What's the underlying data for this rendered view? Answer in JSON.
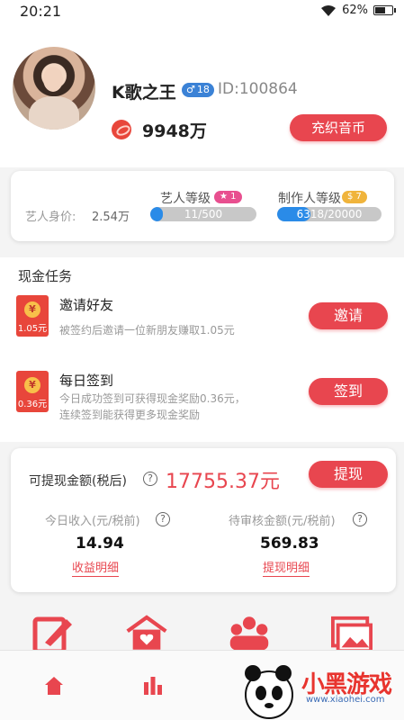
{
  "status_bar": {
    "time": "20:21",
    "battery": "62%",
    "battery_level": 0.62
  },
  "profile": {
    "nickname": "K歌之王",
    "gender_level": "18",
    "user_id": "ID:100864",
    "coins": "9948万",
    "recharge_label": "充织音币"
  },
  "value_card": {
    "worth_label": "艺人身价:",
    "worth_value": "2.54万",
    "artist": {
      "title": "艺人等级",
      "badge": "1",
      "progress_text": "11/500",
      "current": 11,
      "max": 500
    },
    "producer": {
      "title": "制作人等级",
      "badge": "7",
      "progress_text": "6318/20000",
      "current": 6318,
      "max": 20000
    }
  },
  "tasks": {
    "section_title": "现金任务",
    "items": [
      {
        "title": "邀请好友",
        "desc": "被签约后邀请一位新朋友赚取1.05元",
        "desc2": "",
        "envelope_amount": "1.05元",
        "button": "邀请"
      },
      {
        "title": "每日签到",
        "desc": "今日成功签到可获得现金奖励0.36元，",
        "desc2": "连续签到能获得更多现金奖励",
        "envelope_amount": "0.36元",
        "button": "签到"
      }
    ]
  },
  "withdraw": {
    "label": "可提现金额(税后)",
    "amount": "17755.37元",
    "button": "提现",
    "today_label": "今日收入(元/税前)",
    "today_value": "14.94",
    "today_link": "收益明细",
    "pending_label": "待审核金额(元/税前)",
    "pending_value": "569.83",
    "pending_link": "提现明细"
  },
  "colors": {
    "accent": "#e8464f",
    "bar_fill": "#2a8be8",
    "bar_bg": "#c8c8c8",
    "pink_badge": "#e84f8f",
    "gold_badge": "#f0b43c"
  },
  "watermark": {
    "text": "小黑游戏",
    "sub": "www.xiaohei.com"
  }
}
